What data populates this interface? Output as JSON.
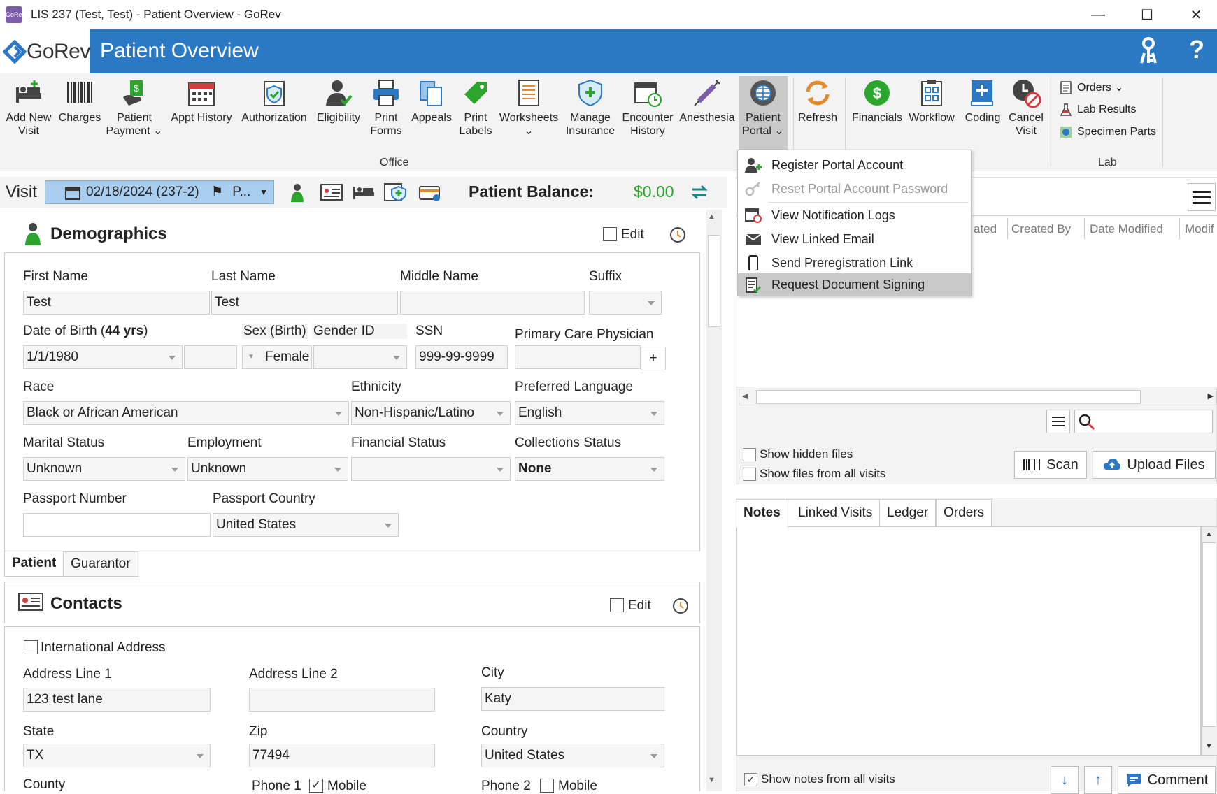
{
  "window": {
    "title": "LIS 237 (Test, Test) - Patient Overview - GoRev",
    "app_icon": "GoRev",
    "controls": {
      "minimize": "—",
      "maximize": "☐",
      "close": "✕"
    }
  },
  "header": {
    "logo_text": "GoRev",
    "page_title": "Patient Overview",
    "brand_color": "#2b78c5"
  },
  "ribbon": {
    "buttons": [
      {
        "label": "Add New\nVisit"
      },
      {
        "label": "Charges"
      },
      {
        "label": "Patient\nPayment ⌄"
      },
      {
        "label": "Appt History"
      },
      {
        "label": "Authorization"
      },
      {
        "label": "Eligibility"
      },
      {
        "label": "Print\nForms"
      },
      {
        "label": "Appeals"
      },
      {
        "label": "Print\nLabels"
      },
      {
        "label": "Worksheets\n⌄"
      },
      {
        "label": "Manage\nInsurance"
      },
      {
        "label": "Encounter\nHistory"
      },
      {
        "label": "Anesthesia"
      },
      {
        "label": "Patient\nPortal ⌄"
      },
      {
        "label": "Refresh"
      },
      {
        "label": "Financials"
      },
      {
        "label": "Workflow"
      },
      {
        "label": "Coding"
      },
      {
        "label": "Cancel\nVisit"
      }
    ],
    "group_office": "Office",
    "group_lab": "Lab",
    "lab_items": {
      "orders": "Orders ⌄",
      "lab_results": "Lab Results",
      "specimen_parts": "Specimen Parts"
    }
  },
  "portal_menu": {
    "items": [
      {
        "label": "Register Portal Account",
        "disabled": false
      },
      {
        "label": "Reset Portal Account Password",
        "disabled": true
      },
      {
        "label": "View Notification Logs",
        "disabled": false
      },
      {
        "label": "View Linked Email",
        "disabled": false
      },
      {
        "label": "Send Preregistration Link",
        "disabled": false
      },
      {
        "label": "Request Document Signing",
        "disabled": false
      }
    ]
  },
  "visit": {
    "label": "Visit",
    "date": "02/18/2024 (237-2)",
    "suffix": "P...",
    "balance_label": "Patient Balance:",
    "balance_value": "$0.00"
  },
  "demographics": {
    "title": "Demographics",
    "edit_label": "Edit",
    "first_name_label": "First Name",
    "first_name": "Test",
    "last_name_label": "Last Name",
    "last_name": "Test",
    "middle_name_label": "Middle Name",
    "middle_name": "",
    "suffix_label": "Suffix",
    "suffix": "",
    "dob_label": "Date of Birth (",
    "dob_age": "44 yrs",
    "dob_close": ")",
    "dob": "1/1/1980",
    "sex_label": "Sex (Birth)",
    "gender_label": "Gender ID",
    "sex": "Female",
    "ssn_label": "SSN",
    "ssn": "999-99-9999",
    "pcp_label": "Primary Care Physician",
    "pcp_add": "+",
    "race_label": "Race",
    "race": "Black or African American",
    "ethnicity_label": "Ethnicity",
    "ethnicity": "Non-Hispanic/Latino",
    "language_label": "Preferred Language",
    "language": "English",
    "marital_label": "Marital Status",
    "marital": "Unknown",
    "employment_label": "Employment",
    "employment": "Unknown",
    "financial_label": "Financial Status",
    "financial": "",
    "collections_label": "Collections Status",
    "collections": "None",
    "passport_label": "Passport Number",
    "passport": "",
    "passport_country_label": "Passport Country",
    "passport_country": "United States",
    "tabs": [
      "Patient",
      "Guarantor"
    ]
  },
  "contacts": {
    "title": "Contacts",
    "edit_label": "Edit",
    "intl_label": "International Address",
    "addr1_label": "Address Line 1",
    "addr1": "123 test lane",
    "addr2_label": "Address Line 2",
    "addr2": "",
    "city_label": "City",
    "city": "Katy",
    "state_label": "State",
    "state": "TX",
    "zip_label": "Zip",
    "zip": "77494",
    "country_label": "Country",
    "country": "United States",
    "county_label": "County",
    "phone1_label": "Phone 1",
    "phone1_mobile": "Mobile",
    "phone2_label": "Phone 2",
    "phone2_mobile": "Mobile"
  },
  "files": {
    "columns": [
      "ated",
      "Created By",
      "Date Modified",
      "Modif"
    ],
    "show_hidden": "Show hidden files",
    "show_all_visits": "Show files from all visits",
    "scan_label": "Scan",
    "upload_label": "Upload Files"
  },
  "notes": {
    "tabs": [
      "Notes",
      "Linked Visits",
      "Ledger",
      "Orders"
    ],
    "show_all": "Show notes from all visits",
    "comment_label": "Comment"
  }
}
